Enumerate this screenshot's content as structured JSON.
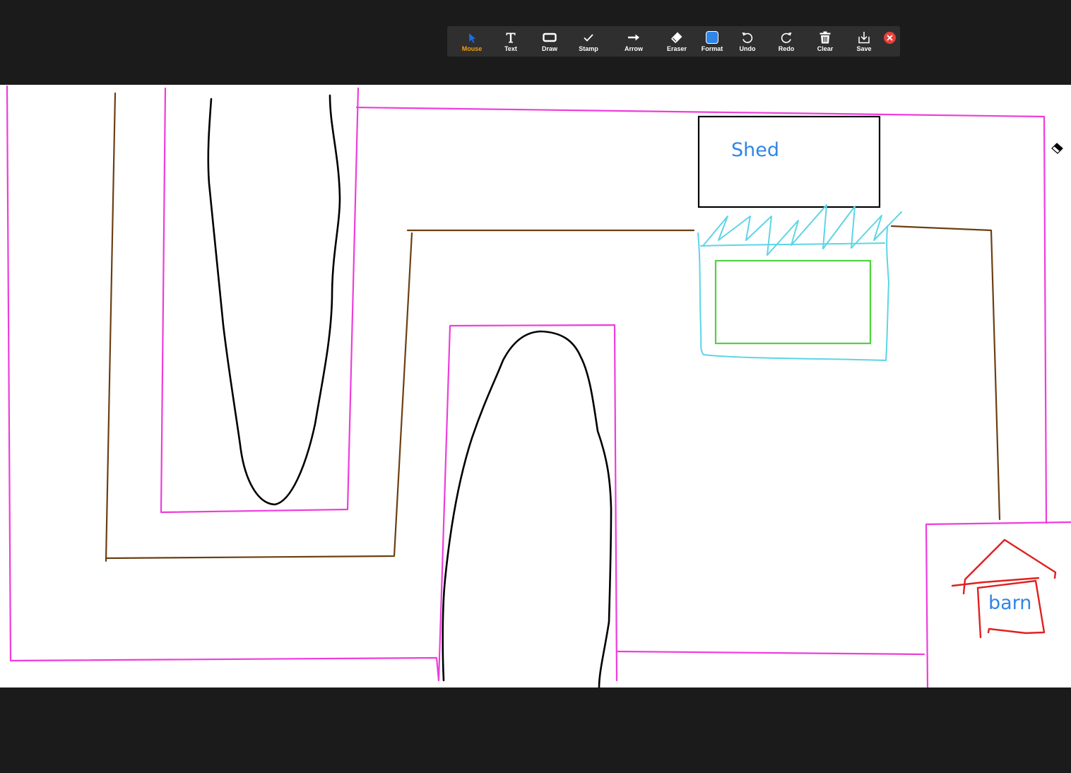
{
  "toolbar": {
    "tools": [
      {
        "id": "mouse",
        "label": "Mouse",
        "icon": "cursor-arrow-icon",
        "active": true
      },
      {
        "id": "text",
        "label": "Text",
        "icon": "text-icon"
      },
      {
        "id": "draw",
        "label": "Draw",
        "icon": "rectangle-icon"
      },
      {
        "id": "stamp",
        "label": "Stamp",
        "icon": "checkmark-icon"
      },
      {
        "id": "arrow",
        "label": "Arrow",
        "icon": "arrow-right-icon"
      },
      {
        "id": "eraser",
        "label": "Eraser",
        "icon": "eraser-icon"
      },
      {
        "id": "format",
        "label": "Format",
        "icon": "color-swatch-icon"
      },
      {
        "id": "undo",
        "label": "Undo",
        "icon": "undo-icon"
      },
      {
        "id": "redo",
        "label": "Redo",
        "icon": "redo-icon"
      },
      {
        "id": "clear",
        "label": "Clear",
        "icon": "trash-icon"
      },
      {
        "id": "save",
        "label": "Save",
        "icon": "save-download-icon"
      }
    ],
    "close_icon": "close-icon"
  },
  "canvas": {
    "labels": {
      "shed": "Shed",
      "barn": "barn"
    },
    "colors": {
      "background": "#1b1b1b",
      "toolbar": "#2f2f2f",
      "active_tool": "#f39c12",
      "format_swatch": "#2f86e6",
      "close": "#e5413a",
      "magenta_outline": "#ee3ddb",
      "brown_path": "#6b3f12",
      "black_ink": "#000000",
      "cyan_ink": "#5dd5e6",
      "green_ink": "#4fd33f",
      "red_ink": "#e02020",
      "label_text": "#2f86e6"
    }
  }
}
